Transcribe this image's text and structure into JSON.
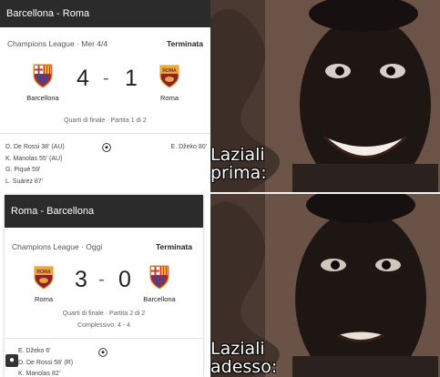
{
  "match_before": {
    "title": "Barcellona - Roma",
    "competition": "Champions League · Mer 4/4",
    "status": "Terminata",
    "home_team": "Barcellona",
    "away_team": "Roma",
    "home_score": "4",
    "away_score": "1",
    "round": "Quarti di finale · Partita 1 di 2",
    "home_scorers": [
      "D. De Rossi 38' (AU)",
      "K. Manolas 55' (AU)",
      "G. Piqué 59'",
      "L. Suárez 87'"
    ],
    "away_scorers": [
      "E. Džeko 80'"
    ]
  },
  "match_after": {
    "title": "Roma - Barcellona",
    "competition": "Champions League · Oggi",
    "status": "Terminata",
    "home_team": "Roma",
    "away_team": "Barcellona",
    "home_score": "3",
    "away_score": "0",
    "round": "Quarti di finale · Partita 2 di 2",
    "aggregate": "Complessivo: 4 - 4",
    "home_scorers": [
      "E. Džeko 6'",
      "D. De Rossi 58' (R)",
      "K. Manolas 82'"
    ]
  },
  "meme": {
    "caption_before_line1": "Laziali",
    "caption_before_line2": "prima:",
    "caption_after_line1": "Laziali",
    "caption_after_line2": "adesso:"
  },
  "icons": {
    "ball": "soccer-ball-icon",
    "barcelona_crest": "barcelona-crest",
    "roma_crest": "roma-crest"
  },
  "colors": {
    "header": "#2b2b2b",
    "barcelona_blue": "#1f4fa0",
    "barcelona_red": "#b3223b",
    "roma_red": "#8e1f2f",
    "roma_gold": "#e6a83a"
  }
}
